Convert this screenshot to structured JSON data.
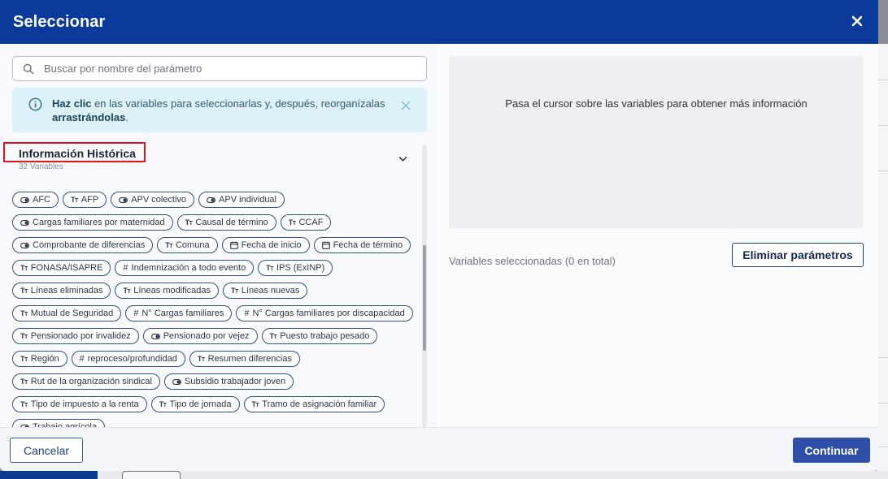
{
  "modal": {
    "title": "Seleccionar",
    "close_icon": "close-icon"
  },
  "search": {
    "placeholder": "Buscar por nombre del parámetro",
    "value": ""
  },
  "info": {
    "bold_start": "Haz clic",
    "text_mid": " en las variables para seleccionarlas y, después, reorganízalas ",
    "bold_end": "arrastrándolas",
    "text_end": "."
  },
  "group": {
    "title": "Información Histórica",
    "subtitle": "32 Variables"
  },
  "chip_rows": [
    [
      {
        "label": "AFC",
        "type": "toggle"
      },
      {
        "label": "AFP",
        "type": "text"
      },
      {
        "label": "APV colectivo",
        "type": "toggle"
      },
      {
        "label": "APV individual",
        "type": "toggle"
      }
    ],
    [
      {
        "label": "Cargas familiares por maternidad",
        "type": "toggle"
      },
      {
        "label": "Causal de término",
        "type": "text"
      },
      {
        "label": "CCAF",
        "type": "text"
      }
    ],
    [
      {
        "label": "Comprobante de diferencias",
        "type": "toggle"
      },
      {
        "label": "Comuna",
        "type": "text"
      },
      {
        "label": "Fecha de inicio",
        "type": "date"
      },
      {
        "label": "Fecha de término",
        "type": "date"
      }
    ],
    [
      {
        "label": "FONASA/ISAPRE",
        "type": "text"
      },
      {
        "label": "Indemnización a todo evento",
        "type": "number"
      },
      {
        "label": "IPS (ExINP)",
        "type": "text"
      }
    ],
    [
      {
        "label": "Líneas eliminadas",
        "type": "text"
      },
      {
        "label": "Líneas modificadas",
        "type": "text"
      },
      {
        "label": "Líneas nuevas",
        "type": "text"
      }
    ],
    [
      {
        "label": "Mutual de Seguridad",
        "type": "text"
      },
      {
        "label": "N° Cargas familiares",
        "type": "number"
      },
      {
        "label": "N° Cargas familiares por discapacidad",
        "type": "number"
      }
    ],
    [
      {
        "label": "Pensionado por invalidez",
        "type": "text"
      },
      {
        "label": "Pensionado por vejez",
        "type": "toggle"
      },
      {
        "label": "Puesto trabajo pesado",
        "type": "text"
      }
    ],
    [
      {
        "label": "Región",
        "type": "text"
      },
      {
        "label": "reproceso/profundidad",
        "type": "number"
      },
      {
        "label": "Resumen diferencias",
        "type": "text"
      }
    ],
    [
      {
        "label": "Rut de la organización sindical",
        "type": "text"
      },
      {
        "label": "Subsidio trabajador joven",
        "type": "toggle"
      }
    ],
    [
      {
        "label": "Tipo de impuesto a la renta",
        "type": "text"
      },
      {
        "label": "Tipo de jornada",
        "type": "text"
      },
      {
        "label": "Tramo de asignación familiar",
        "type": "text"
      }
    ],
    [
      {
        "label": "Trabajo agrícola",
        "type": "toggle"
      }
    ]
  ],
  "right": {
    "hover_hint": "Pasa el cursor sobre las variables para obtener más información",
    "selected_label": "Variables seleccionadas (0 en total)",
    "delete_label": "Eliminar parámetros"
  },
  "footer": {
    "cancel_label": "Cancelar",
    "continue_label": "Continuar"
  },
  "colors": {
    "header": "#0a3a9a",
    "info_bg": "#ddf1f8",
    "highlight_box": "#e0141e",
    "primary_button": "#2e4ea7"
  }
}
